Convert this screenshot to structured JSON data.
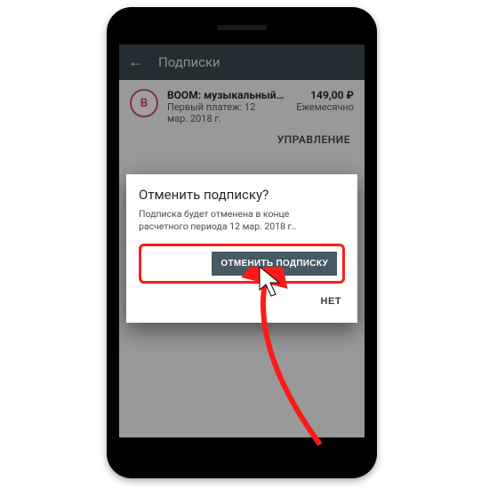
{
  "header": {
    "title": "Подписки"
  },
  "subscription": {
    "icon_letter": "B",
    "title": "BOOM: музыкальный…",
    "desc_line1": "Первый платеж: 12",
    "desc_line2": "мар. 2018 г.",
    "price": "149,00 ₽",
    "period": "Ежемесячно",
    "manage_label": "УПРАВЛЕНИЕ"
  },
  "dialog": {
    "title": "Отменить подписку?",
    "body_line1": "Подписка будет отменена в конце",
    "body_line2": "расчетного периода 12 мар. 2018 г..",
    "confirm_label": "ОТМЕНИТЬ ПОДПИСКУ",
    "cancel_label": "НЕТ"
  }
}
